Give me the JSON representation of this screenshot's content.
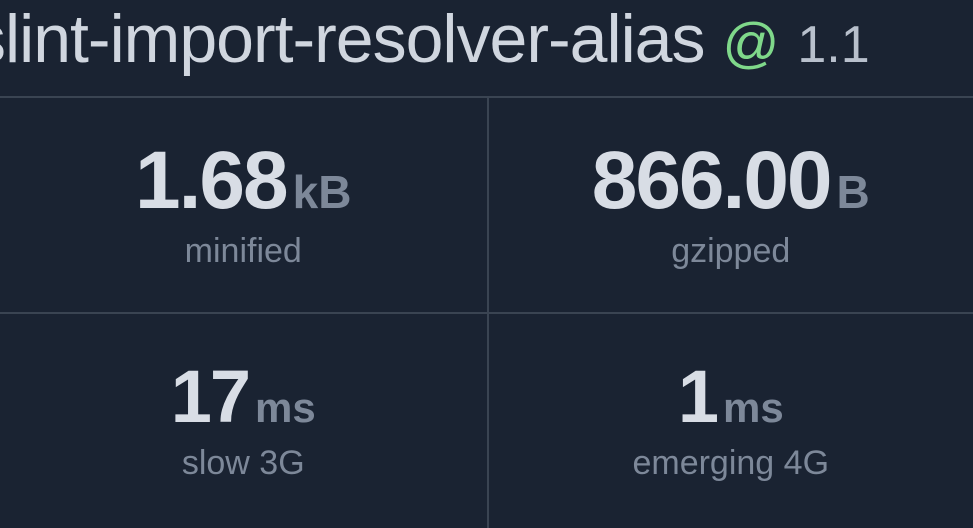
{
  "header": {
    "package_name": "slint-import-resolver-alias",
    "at": "@",
    "version": "1.1"
  },
  "stats": {
    "minified": {
      "value": "1.68",
      "unit": "kB",
      "label": "minified"
    },
    "gzipped": {
      "value": "866.00",
      "unit": "B",
      "label": "gzipped"
    },
    "slow3g": {
      "value": "17",
      "unit": "ms",
      "label": "slow 3G"
    },
    "emerging4g": {
      "value": "1",
      "unit": "ms",
      "label": "emerging 4G"
    }
  }
}
